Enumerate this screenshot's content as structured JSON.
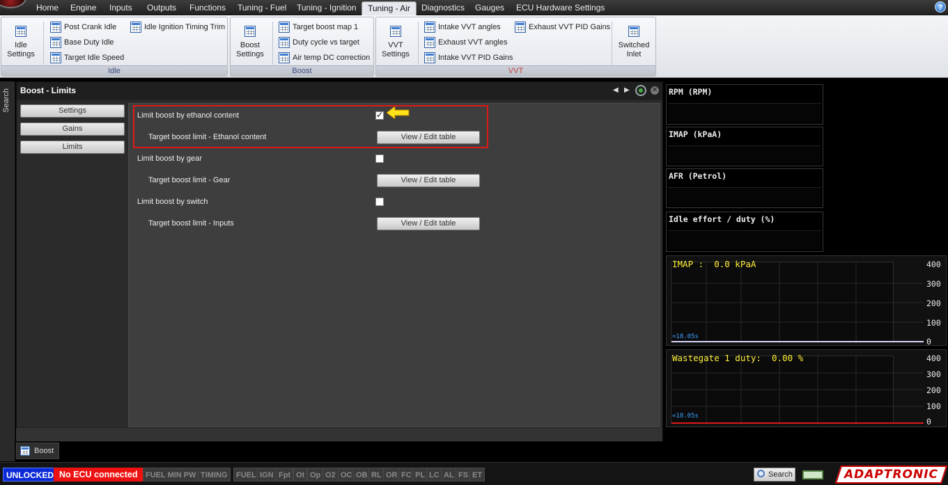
{
  "menu": {
    "tabs": [
      "Home",
      "Engine",
      "Inputs",
      "Outputs",
      "Functions",
      "Tuning - Fuel",
      "Tuning - Ignition",
      "Tuning - Air",
      "Diagnostics",
      "Gauges",
      "ECU Hardware Settings"
    ],
    "active_tab": "Tuning - Air",
    "help": "?"
  },
  "ribbon": {
    "idle": {
      "caption": "Idle",
      "big": {
        "line1": "Idle",
        "line2": "Settings"
      },
      "items": [
        "Post Crank Idle",
        "Base Duty Idle",
        "Target Idle Speed",
        "Idle Ignition Timing Trim"
      ]
    },
    "boost": {
      "caption": "Boost",
      "big": {
        "line1": "Boost",
        "line2": "Settings"
      },
      "items": [
        "Target boost map 1",
        "Duty cycle vs target",
        "Air temp DC correction"
      ]
    },
    "vvt": {
      "caption": "VVT",
      "big": {
        "line1": "VVT",
        "line2": "Settings"
      },
      "items": [
        "Intake VVT angles",
        "Exhaust VVT angles",
        "Intake VVT PID Gains",
        "Exhaust VVT PID Gains"
      ],
      "switched": {
        "line1": "Switched",
        "line2": "Inlet"
      }
    }
  },
  "sidebar": {
    "search_label": "Search"
  },
  "panel": {
    "title": "Boost - Limits",
    "controls": {
      "prev": "◀",
      "next": "▶",
      "close": "✕"
    },
    "nav": [
      "Settings",
      "Gains",
      "Limits"
    ],
    "rows": [
      {
        "label": "Limit boost by ethanol content",
        "checked": true,
        "sub_label": "Target boost limit - Ethanol content",
        "button": "View / Edit table"
      },
      {
        "label": "Limit boost by gear",
        "checked": false,
        "sub_label": "Target boost limit - Gear",
        "button": "View / Edit table"
      },
      {
        "label": "Limit boost by switch",
        "checked": false,
        "sub_label": "Target boost limit - Inputs",
        "button": "View / Edit table"
      }
    ],
    "bottom_tab": "Boost"
  },
  "gauges": [
    {
      "title": "RPM (RPM)"
    },
    {
      "title": "IMAP  (kPaA)"
    },
    {
      "title": "AFR (Petrol)"
    },
    {
      "title": "Idle effort / duty (%)"
    }
  ],
  "graphs": [
    {
      "title": "IMAP :  0.0 kPaA",
      "time": "=18.05s",
      "y_ticks": [
        "400",
        "300",
        "200",
        "100",
        "0"
      ],
      "line_color": "#d8d8ff"
    },
    {
      "title": "Wastegate 1 duty:  0.00 %",
      "time": "=18.05s",
      "y_ticks": [
        "400",
        "300",
        "200",
        "100",
        "0"
      ],
      "line_color": "#e01818"
    }
  ],
  "status": {
    "unlocked": "UNLOCKED",
    "ecu": "No ECU connected",
    "flags": [
      "FUEL MIN PW",
      "TIMING",
      "FUEL",
      "IGN",
      "Fpt",
      "Ot",
      "Op",
      "O2",
      "OC",
      "OB",
      "RL",
      "OR",
      "FC",
      "PL",
      "LC",
      "AL",
      "FS",
      "ET"
    ],
    "search": "Search",
    "brand": "ADAPTRONIC"
  },
  "colors": {
    "accent": "#e01818",
    "unlocked_bg": "#0a2ad8",
    "graph_title": "#ffef3a"
  }
}
